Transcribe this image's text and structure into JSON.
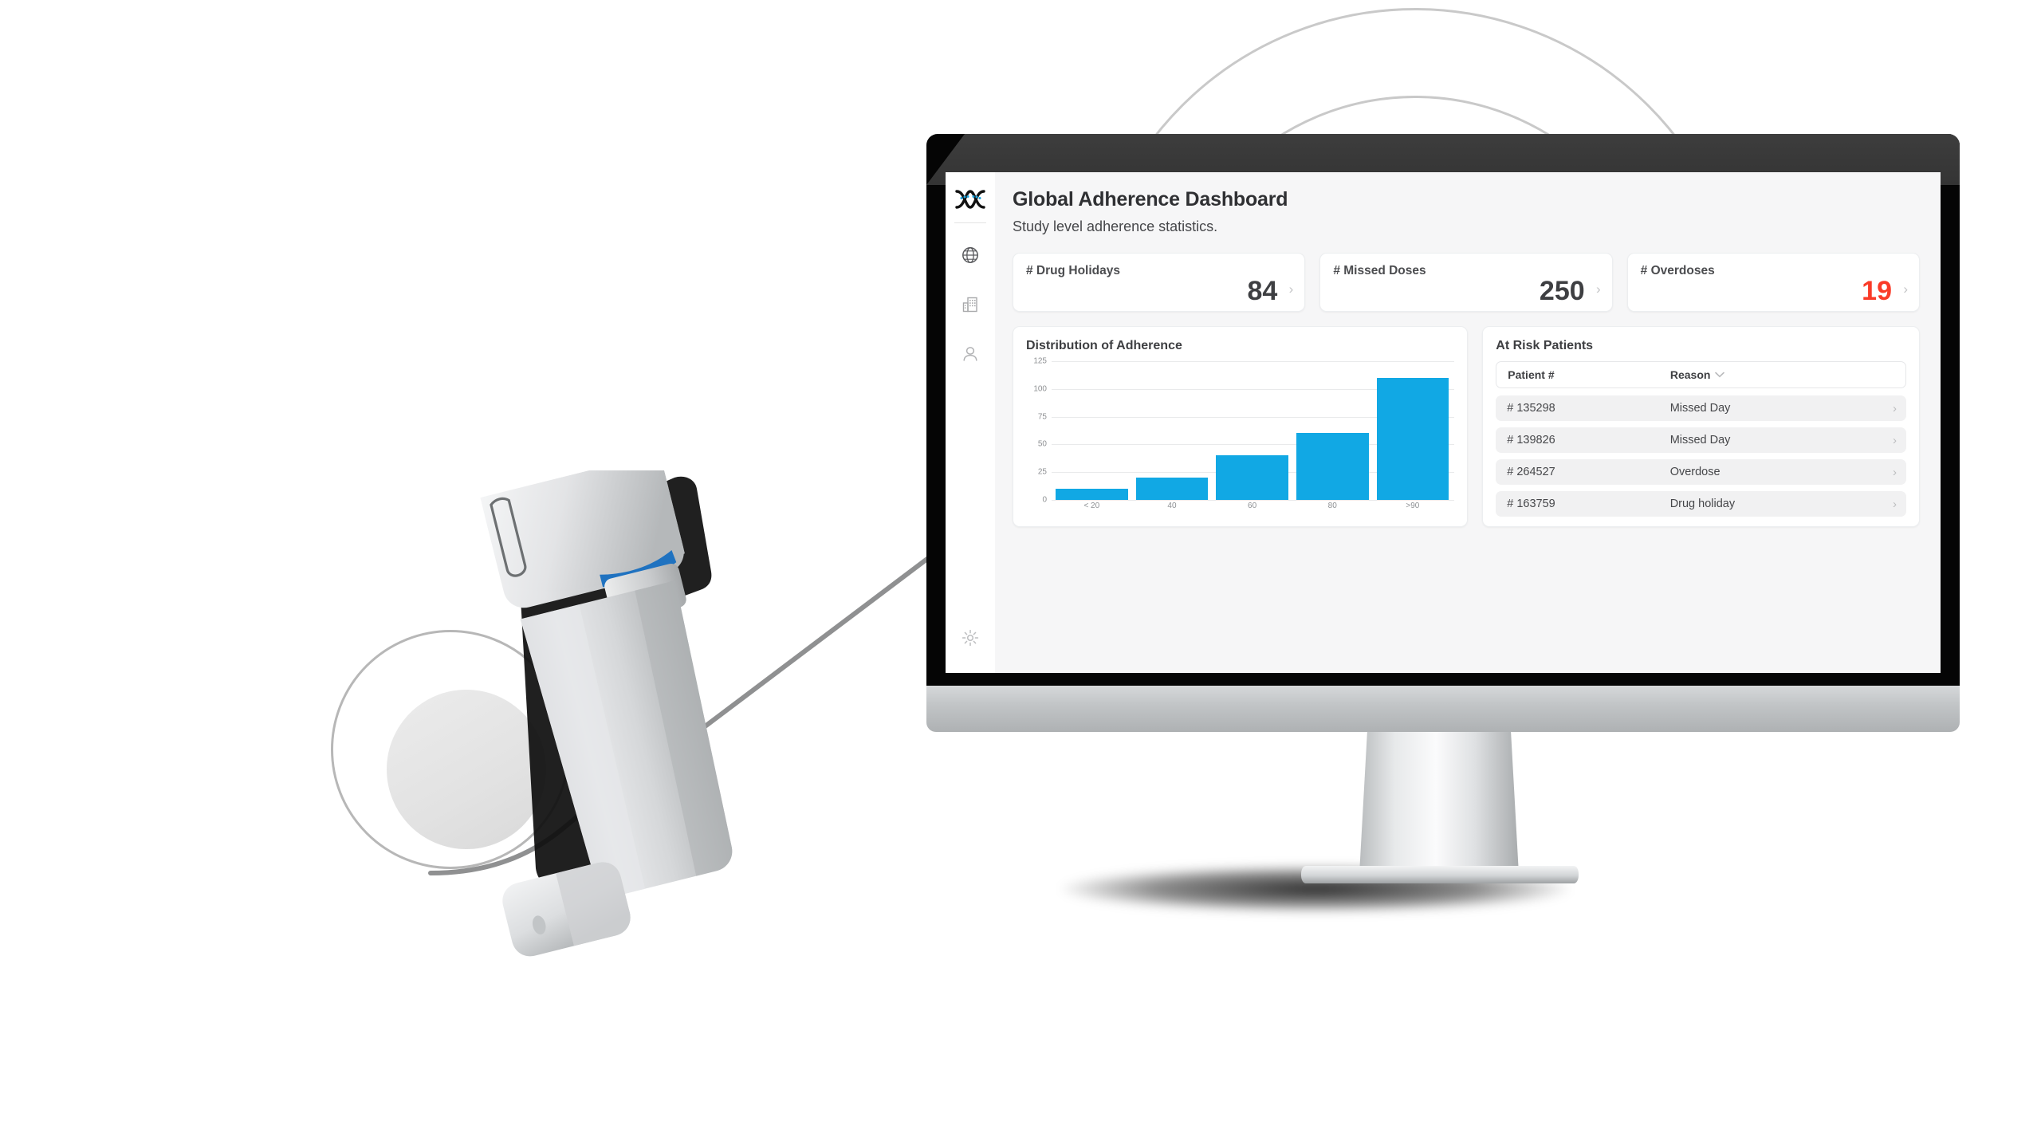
{
  "app": {
    "sidebar": {
      "logo_name": "dna-helix-logo",
      "items": [
        {
          "icon": "globe-icon",
          "name": "sidebar-item-global"
        },
        {
          "icon": "building-icon",
          "name": "sidebar-item-sites"
        },
        {
          "icon": "person-icon",
          "name": "sidebar-item-patients"
        }
      ],
      "footer_item": {
        "icon": "gear-icon",
        "name": "sidebar-item-settings"
      }
    },
    "header": {
      "title": "Global Adherence Dashboard",
      "subtitle": "Study level adherence statistics."
    },
    "stats": [
      {
        "label": "# Drug Holidays",
        "value": "84",
        "danger": false,
        "chevron": "›"
      },
      {
        "label": "# Missed Doses",
        "value": "250",
        "danger": false,
        "chevron": "›"
      },
      {
        "label": "# Overdoses",
        "value": "19",
        "danger": true,
        "chevron": "›"
      }
    ],
    "chart_panel": {
      "title": "Distribution of Adherence"
    },
    "table_panel": {
      "title": "At Risk Patients",
      "columns": [
        "Patient #",
        "Reason"
      ],
      "sort_icon": "chevron-down-icon",
      "rows": [
        {
          "patient": "# 135298",
          "reason": "Missed Day",
          "chevron": "›"
        },
        {
          "patient": "# 139826",
          "reason": "Missed Day",
          "chevron": "›"
        },
        {
          "patient": "# 264527",
          "reason": "Overdose",
          "chevron": "›"
        },
        {
          "patient": "# 163759",
          "reason": "Drug holiday",
          "chevron": "›"
        }
      ]
    }
  },
  "colors": {
    "bar_blue": "#11a8e4",
    "danger_red": "#fa3b28",
    "text_dark": "#3e3f42",
    "panel_bg": "#ffffff",
    "app_bg": "#f6f6f7",
    "row_bg": "#f1f1f2"
  },
  "chart_data": {
    "type": "bar",
    "title": "Distribution of Adherence",
    "xlabel": "",
    "ylabel": "",
    "categories": [
      "< 20",
      "40",
      "60",
      "80",
      ">90"
    ],
    "values": [
      10,
      20,
      40,
      60,
      110
    ],
    "ylim": [
      0,
      125
    ],
    "yticks": [
      0,
      25,
      50,
      75,
      100,
      125
    ],
    "grid": true,
    "legend": false,
    "series_color": "#11a8e4"
  }
}
